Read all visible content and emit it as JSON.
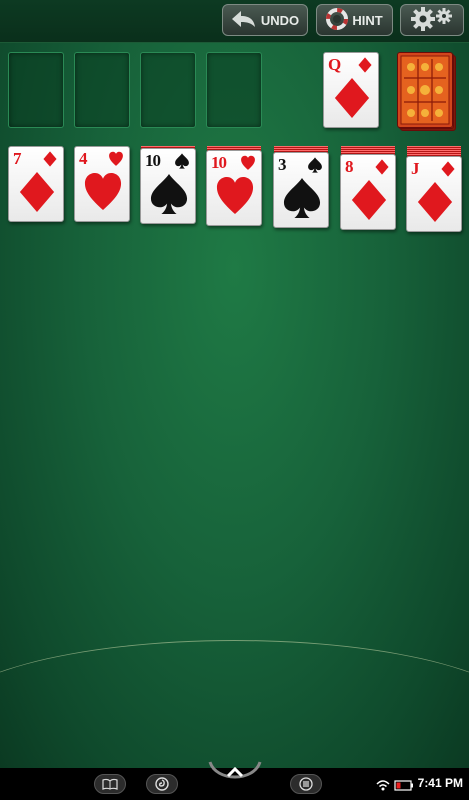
{
  "toolbar": {
    "undo_label": "UNDO",
    "hint_label": "HINT",
    "undo_icon": "arrow-back-icon",
    "hint_icon": "lifebuoy-icon",
    "settings_icon": "gear-icon"
  },
  "foundations": {
    "count": 4,
    "empty": true
  },
  "waste": {
    "rank": "Q",
    "suit": "diamonds",
    "color": "red"
  },
  "stock": {
    "icon": "card-back-icon",
    "back_color": "#d2451c"
  },
  "tableau": [
    {
      "rank": "7",
      "suit": "diamonds",
      "color": "red",
      "hidden_under": 0
    },
    {
      "rank": "4",
      "suit": "hearts",
      "color": "red",
      "hidden_under": 0
    },
    {
      "rank": "10",
      "suit": "spades",
      "color": "black",
      "hidden_under": 1
    },
    {
      "rank": "10",
      "suit": "hearts",
      "color": "red",
      "hidden_under": 2
    },
    {
      "rank": "3",
      "suit": "spades",
      "color": "black",
      "hidden_under": 3
    },
    {
      "rank": "8",
      "suit": "diamonds",
      "color": "red",
      "hidden_under": 4
    },
    {
      "rank": "J",
      "suit": "diamonds",
      "color": "red",
      "hidden_under": 5
    }
  ],
  "statusbar": {
    "time": "7:41 PM",
    "wifi_icon": "wifi-icon",
    "battery_icon": "battery-icon"
  },
  "navbar": {
    "books_icon": "book-icon",
    "apps_icon": "swirl-icon",
    "home_icon": "chevron-up-icon",
    "menu_icon": "menu-icon"
  },
  "colors": {
    "felt": "#17623a",
    "suit_red": "#e0181e",
    "suit_black": "#111111"
  }
}
